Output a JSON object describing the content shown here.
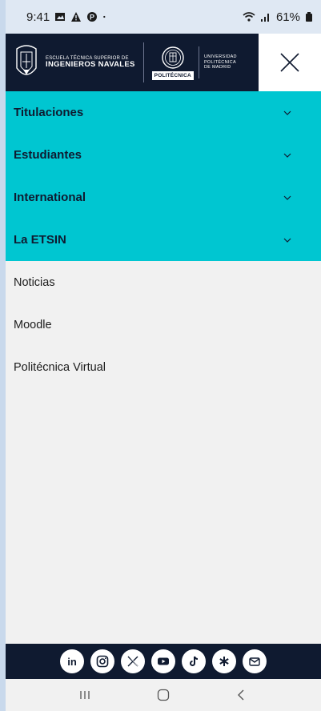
{
  "status": {
    "time": "9:41",
    "battery": "61%"
  },
  "header": {
    "etsin_small": "ESCUELA TÉCNICA SUPERIOR DE",
    "etsin_big": "INGENIEROS NAVALES",
    "upm_badge": "POLITÉCNICA",
    "upm_line1": "UNIVERSIDAD",
    "upm_line2": "POLITÉCNICA",
    "upm_line3": "DE MADRID"
  },
  "menu": {
    "primary": [
      {
        "label": "Titulaciones"
      },
      {
        "label": "Estudiantes"
      },
      {
        "label": "International"
      },
      {
        "label": "La ETSIN"
      }
    ],
    "secondary": [
      {
        "label": "Noticias"
      },
      {
        "label": "Moodle"
      },
      {
        "label": "Politécnica Virtual"
      }
    ]
  },
  "social": [
    "linkedin-icon",
    "instagram-icon",
    "x-icon",
    "youtube-icon",
    "tiktok-icon",
    "asterisk-icon",
    "mail-icon"
  ],
  "colors": {
    "navy": "#0f1a30",
    "cyan": "#00c6d1",
    "background": "#f1f1f1"
  }
}
